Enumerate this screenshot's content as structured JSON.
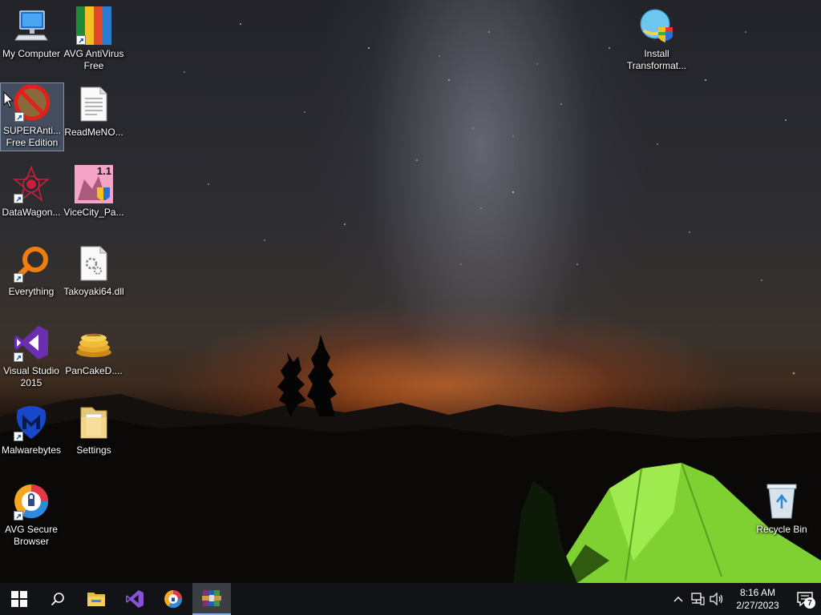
{
  "desktop": {
    "icons": [
      {
        "label": "My Computer"
      },
      {
        "label": "AVG AntiVirus Free"
      },
      {
        "label": "SUPERAnti... Free Edition"
      },
      {
        "label": "ReadMeNO..."
      },
      {
        "label": "DataWagon..."
      },
      {
        "label": "ViceCity_Pa..."
      },
      {
        "label": "Everything"
      },
      {
        "label": "Takoyaki64.dll"
      },
      {
        "label": "Visual Studio 2015"
      },
      {
        "label": "PanCakeD...."
      },
      {
        "label": "Malwarebytes"
      },
      {
        "label": "Settings"
      },
      {
        "label": "AVG Secure Browser"
      },
      {
        "label": "Install Transformat..."
      },
      {
        "label": "Recycle Bin"
      }
    ],
    "vicecity_badge": "1.1"
  },
  "taskbar": {
    "pinned": [
      {
        "icon": "windows-start-icon"
      },
      {
        "icon": "search-icon"
      },
      {
        "icon": "file-explorer-icon"
      },
      {
        "icon": "visual-studio-icon"
      },
      {
        "icon": "avg-browser-icon"
      },
      {
        "icon": "winrar-icon"
      }
    ],
    "clock": {
      "time": "8:16 AM",
      "date": "2/27/2023"
    },
    "notification_count": "7"
  },
  "colors": {
    "taskbar": "#111316",
    "accent": "#7fb2e5",
    "tent": "#8fe23a"
  }
}
